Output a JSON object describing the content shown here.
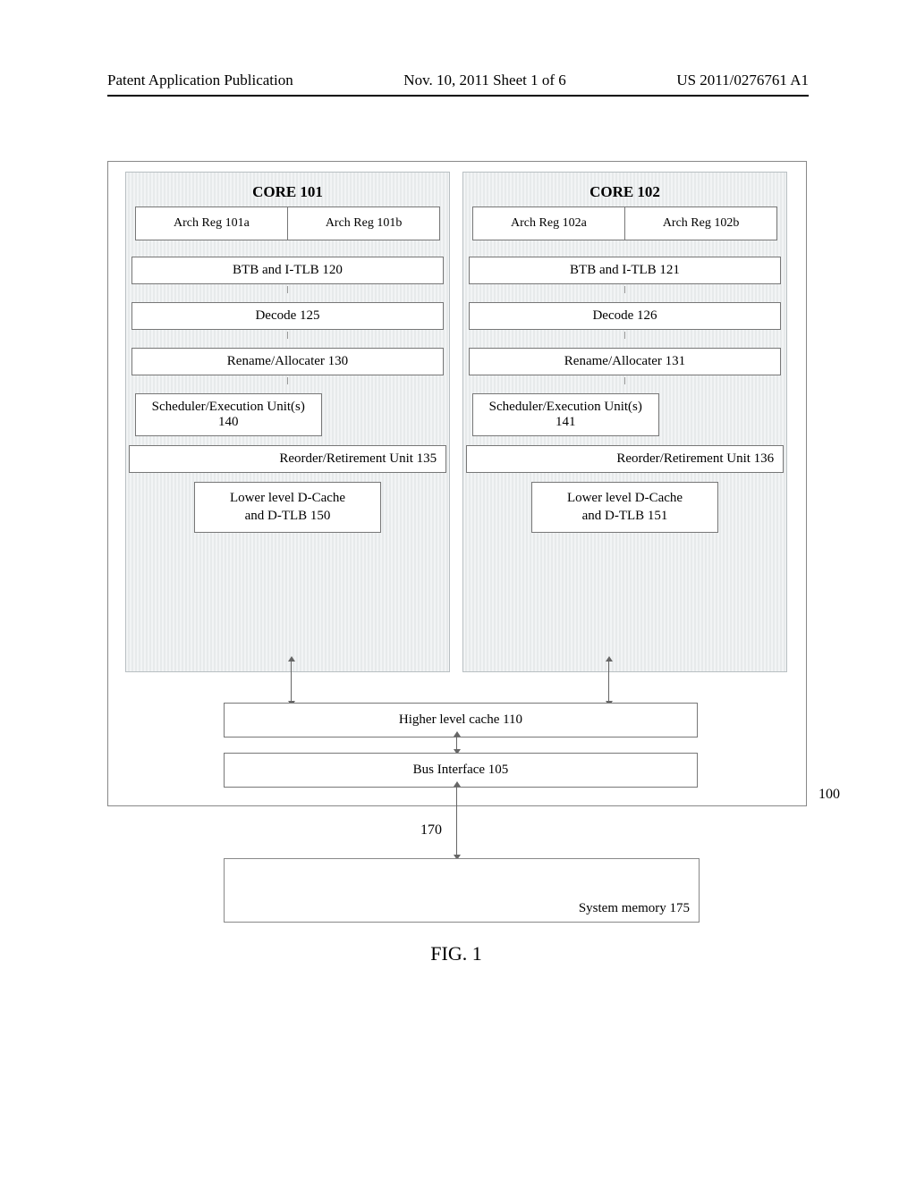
{
  "header": {
    "left": "Patent Application Publication",
    "middle": "Nov. 10, 2011  Sheet 1 of 6",
    "right": "US 2011/0276761 A1"
  },
  "cores": [
    {
      "title": "CORE 101",
      "regs": [
        "Arch Reg 101a",
        "Arch Reg 101b"
      ],
      "btb": "BTB and I-TLB 120",
      "decode": "Decode 125",
      "rename": "Rename/Allocater 130",
      "sched": "Scheduler/Execution Unit(s)\n140",
      "reorder": "Reorder/Retirement Unit 135",
      "dcache": "Lower level D-Cache\nand D-TLB 150"
    },
    {
      "title": "CORE 102",
      "regs": [
        "Arch Reg 102a",
        "Arch Reg 102b"
      ],
      "btb": "BTB and I-TLB 121",
      "decode": "Decode 126",
      "rename": "Rename/Allocater 131",
      "sched": "Scheduler/Execution Unit(s)\n141",
      "reorder": "Reorder/Retirement Unit 136",
      "dcache": "Lower level D-Cache\nand D-TLB 151"
    }
  ],
  "hlc": "Higher level cache 110",
  "busif": "Bus Interface 105",
  "chip_label": "100",
  "bus_label": "170",
  "sysmem": "System memory 175",
  "caption": "FIG. 1"
}
